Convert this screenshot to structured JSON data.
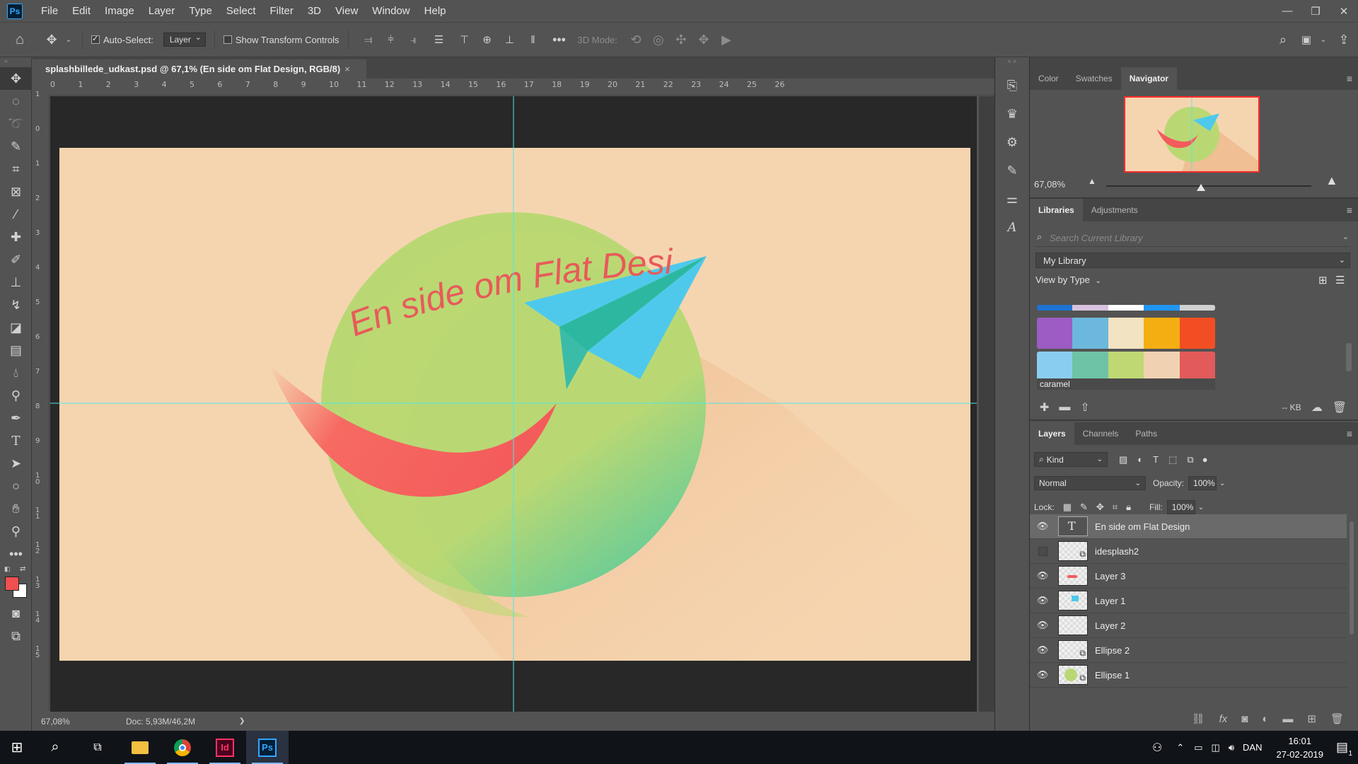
{
  "app": {
    "logo": "Ps",
    "menu": [
      "File",
      "Edit",
      "Image",
      "Layer",
      "Type",
      "Select",
      "Filter",
      "3D",
      "View",
      "Window",
      "Help"
    ]
  },
  "options": {
    "auto_select_label": "Auto-Select:",
    "auto_select_value": "Layer",
    "show_transform_label": "Show Transform Controls",
    "mode_3d_label": "3D Mode:"
  },
  "document": {
    "tab_title": "splashbillede_udkast.psd @ 67,1% (En side om Flat Design, RGB/8)",
    "tab_close": "×",
    "canvas_text": "En side om Flat Design",
    "ruler_top": [
      "0",
      "1",
      "2",
      "3",
      "4",
      "5",
      "6",
      "7",
      "8",
      "9",
      "10",
      "11",
      "12",
      "13",
      "14",
      "15",
      "16",
      "17",
      "18",
      "19",
      "20",
      "21",
      "22",
      "23",
      "24",
      "25",
      "26"
    ],
    "ruler_left": [
      "1",
      "0",
      "1",
      "2",
      "3",
      "4",
      "5",
      "6",
      "7",
      "8",
      "9",
      "1\n0",
      "1\n1",
      "1\n2",
      "1\n3",
      "1\n4",
      "1\n5"
    ]
  },
  "status": {
    "zoom": "67,08%",
    "doc": "Doc: 5,93M/46,2M",
    "arrow": "❯"
  },
  "navigator": {
    "tabs": [
      "Color",
      "Swatches",
      "Navigator"
    ],
    "active_tab": "Navigator",
    "zoom": "67,08%"
  },
  "libraries": {
    "tabs": [
      "Libraries",
      "Adjustments"
    ],
    "search_placeholder": "Search Current Library",
    "library_name": "My Library",
    "view_by": "View by Type",
    "swatch_sets": [
      {
        "colors": [
          "#1e73d2",
          "#d8c3e0",
          "#ffffff",
          "#2196f3",
          "#d0d0d0"
        ]
      },
      {
        "colors": [
          "#9c5cc4",
          "#6cb8dc",
          "#f2e3c2",
          "#f4ae12",
          "#f24e24"
        ]
      },
      {
        "colors": [
          "#89cef0",
          "#6ec3a6",
          "#bfd873",
          "#f0d2b2",
          "#e25a5a"
        ],
        "name": "caramel"
      }
    ],
    "footer_size": "-- KB"
  },
  "layers": {
    "tabs": [
      "Layers",
      "Channels",
      "Paths"
    ],
    "kind_label": "Kind",
    "blend_mode": "Normal",
    "opacity_label": "Opacity:",
    "opacity_value": "100%",
    "lock_label": "Lock:",
    "fill_label": "Fill:",
    "fill_value": "100%",
    "items": [
      {
        "name": "En side om Flat Design",
        "visible": true,
        "selected": true,
        "kind": "text"
      },
      {
        "name": "idesplash2",
        "visible": false,
        "selected": false,
        "kind": "smart"
      },
      {
        "name": "Layer 3",
        "visible": true,
        "selected": false,
        "kind": "pixel"
      },
      {
        "name": "Layer 1",
        "visible": true,
        "selected": false,
        "kind": "pixel"
      },
      {
        "name": "Layer 2",
        "visible": true,
        "selected": false,
        "kind": "pixel"
      },
      {
        "name": "Ellipse 2",
        "visible": true,
        "selected": false,
        "kind": "shape"
      },
      {
        "name": "Ellipse 1",
        "visible": true,
        "selected": false,
        "kind": "shape"
      }
    ]
  },
  "taskbar": {
    "language": "DAN",
    "time": "16:01",
    "date": "27-02-2019",
    "notification_count": "1"
  },
  "colors": {
    "canvas_bg": "#f5d5b0",
    "circle_green": "#b9d874",
    "circle_teal": "#6ccf9a",
    "smile_red": "#f45b5b",
    "plane_blue": "#4ec9ec",
    "plane_teal": "#2cb8a0",
    "shadow": "#eeb787",
    "title_red": "#e85a5a",
    "guide": "#4fe6e6"
  }
}
